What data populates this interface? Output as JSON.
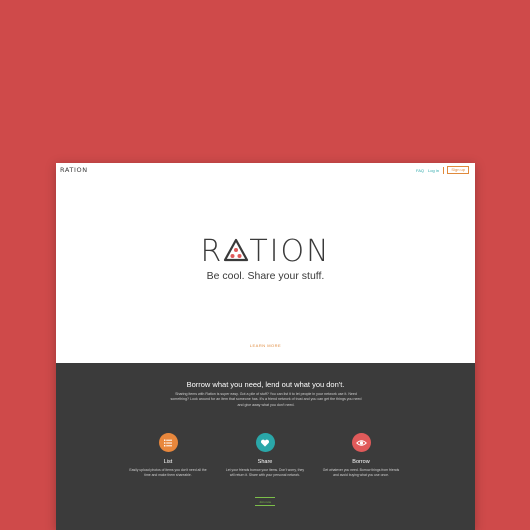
{
  "header": {
    "logo": "RATION",
    "nav": {
      "faq": "FAQ",
      "login": "Log in",
      "signup": "Sign up"
    }
  },
  "hero": {
    "logo_prefix": "R",
    "logo_suffix": "TION",
    "tagline": "Be cool. Share your stuff.",
    "learn_more": "LEARN MORE"
  },
  "info": {
    "headline": "Borrow what you need, lend out what you don't.",
    "p1": "Sharing items with Ration is super easy. Got a pile of stuff? You can list it to let people in your",
    "p2": "network use it. Need something? Look around for an item that someone has. It's a friend",
    "p3": "network of trust and you can get the things you need and give away what you don't need."
  },
  "features": [
    {
      "title": "List",
      "desc": "Easily upload photos of items you don't need all the time and make them shareable."
    },
    {
      "title": "Share",
      "desc": "Let your friends borrow your items. Don't worry, they will return it. Share with your personal network."
    },
    {
      "title": "Borrow",
      "desc": "Get whatever you need. Borrow things from friends and avoid buying what you use once."
    }
  ],
  "cta": {
    "label": "Join now"
  },
  "colors": {
    "background": "#cf4a4a",
    "list": "#e8873c",
    "share": "#2aa7a9",
    "borrow": "#e05a5a",
    "accent": "#e08a3c",
    "join": "#7cbf4a"
  }
}
